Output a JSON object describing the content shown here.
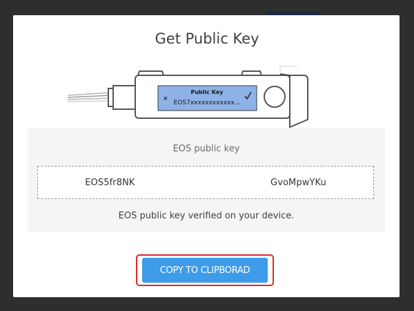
{
  "modal": {
    "title": "Get Public Key"
  },
  "device": {
    "screen_title": "Public Key",
    "screen_value": "EOS7xxxxxxxxxxxx..."
  },
  "info": {
    "label": "EOS public key",
    "key_value": "EOS5fr8NK               GvoMpwYKu",
    "verified_text": "EOS public key verified on your device."
  },
  "actions": {
    "copy_label": "COPY TO CLIPBORAD"
  },
  "colors": {
    "button": "#3d9be9",
    "highlight": "#d9282f",
    "device_screen": "#8fb2e6"
  },
  "icons": {
    "device_reject": "x-icon",
    "device_confirm": "check-icon"
  }
}
